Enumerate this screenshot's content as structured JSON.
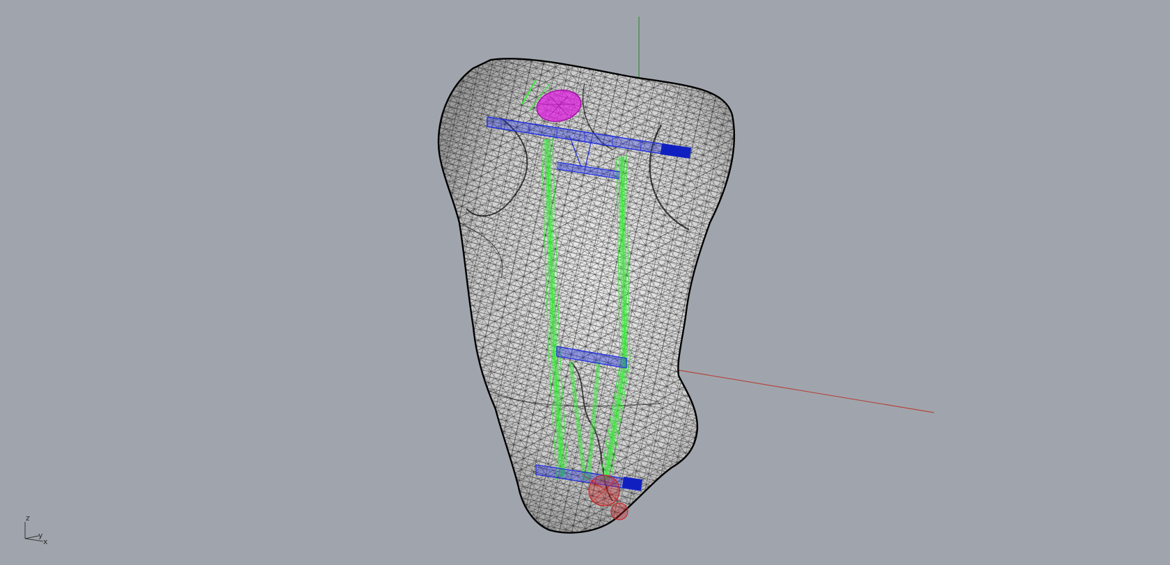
{
  "viewport": {
    "display_mode": "wireframe",
    "background_color": "#a0a5ad"
  },
  "world_axes": {
    "x_axis_color": "#b4463c",
    "y_axis_color": "#3a8a3a"
  },
  "axis_widget": {
    "z_label": "z",
    "y_label": "y",
    "x_label": "x"
  },
  "objects": {
    "mesh": {
      "color": "#000000",
      "fill": "#d8d8d8"
    },
    "guide_rails": {
      "color": "#33ee33"
    },
    "screws": {
      "color": "#1f2fe0"
    },
    "entry_marker": {
      "color": "#e020e0"
    },
    "target_marker": {
      "color": "#d02020"
    }
  }
}
